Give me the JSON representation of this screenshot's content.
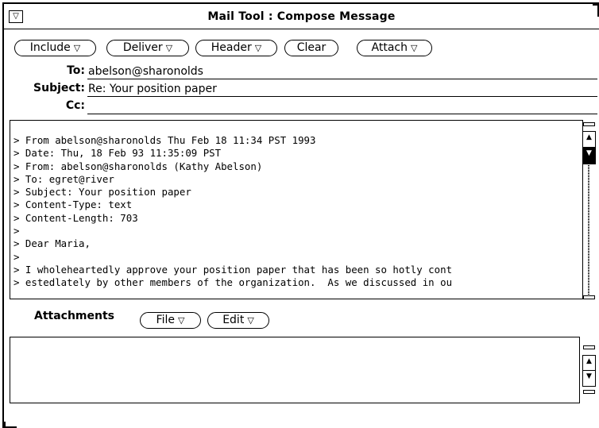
{
  "window": {
    "title": "Mail Tool : Compose Message",
    "menu_glyph": "▽"
  },
  "toolbar": {
    "buttons": [
      {
        "label": "Include",
        "has_menu": true
      },
      {
        "label": "Deliver",
        "has_menu": true
      },
      {
        "label": "Header",
        "has_menu": true
      },
      {
        "label": "Clear",
        "has_menu": false
      },
      {
        "label": "Attach",
        "has_menu": true
      }
    ],
    "menu_glyph": "▽"
  },
  "header_fields": {
    "to": {
      "label": "To:",
      "value": "abelson@sharonolds"
    },
    "subject": {
      "label": "Subject:",
      "value": "Re: Your position paper"
    },
    "cc": {
      "label": "Cc:",
      "value": ""
    }
  },
  "message": {
    "lines": [
      "> From abelson@sharonolds Thu Feb 18 11:34 PST 1993",
      "> Date: Thu, 18 Feb 93 11:35:09 PST",
      "> From: abelson@sharonolds (Kathy Abelson)",
      "> To: egret@river",
      "> Subject: Your position paper",
      "> Content-Type: text",
      "> Content-Length: 703",
      ">",
      "> Dear Maria,",
      ">",
      "> I wholeheartedly approve your position paper that has been so hotly cont",
      "> estedlately by other members of the organization.  As we discussed in ou"
    ]
  },
  "attachments": {
    "label": "Attachments",
    "buttons": [
      {
        "label": "File",
        "has_menu": true
      },
      {
        "label": "Edit",
        "has_menu": true
      }
    ],
    "menu_glyph": "▽"
  },
  "scrollbar_glyphs": {
    "up": "▲",
    "down": "▼"
  }
}
